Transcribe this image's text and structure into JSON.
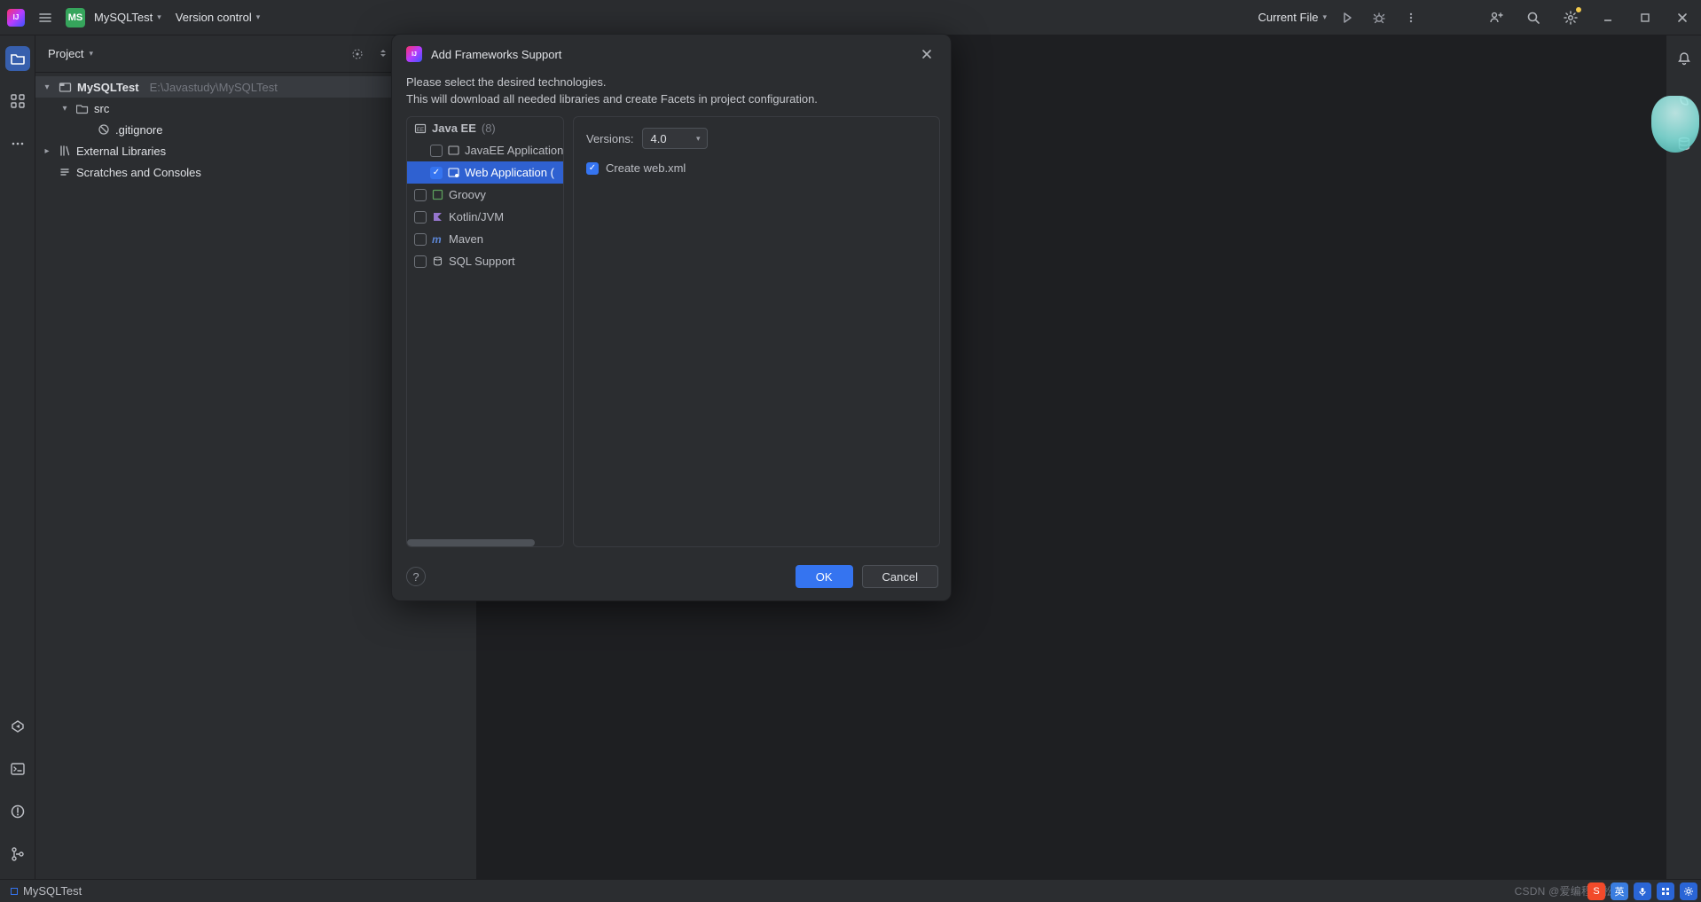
{
  "toolbar": {
    "project_badge": "MS",
    "project_name": "MySQLTest",
    "version_control": "Version control",
    "run_target": "Current File"
  },
  "project_pane": {
    "title": "Project",
    "root_name": "MySQLTest",
    "root_path": "E:\\Javastudy\\MySQLTest",
    "src": "src",
    "gitignore": ".gitignore",
    "external_libraries": "External Libraries",
    "scratches": "Scratches and Consoles"
  },
  "dialog": {
    "title": "Add Frameworks Support",
    "desc1": "Please select the desired technologies.",
    "desc2": "This will download all needed libraries and create Facets in project configuration.",
    "java_ee": "Java EE",
    "java_ee_count": "(8)",
    "javaee_application": "JavaEE Application",
    "web_application": "Web Application (",
    "groovy": "Groovy",
    "kotlin": "Kotlin/JVM",
    "maven": "Maven",
    "sql_support": "SQL Support",
    "versions_label": "Versions:",
    "version_value": "4.0",
    "create_webxml": "Create web.xml",
    "ok": "OK",
    "cancel": "Cancel"
  },
  "status": {
    "project": "MySQLTest"
  },
  "watermark": "CSDN @爱编程的松子",
  "tray": {
    "eng": "英"
  }
}
